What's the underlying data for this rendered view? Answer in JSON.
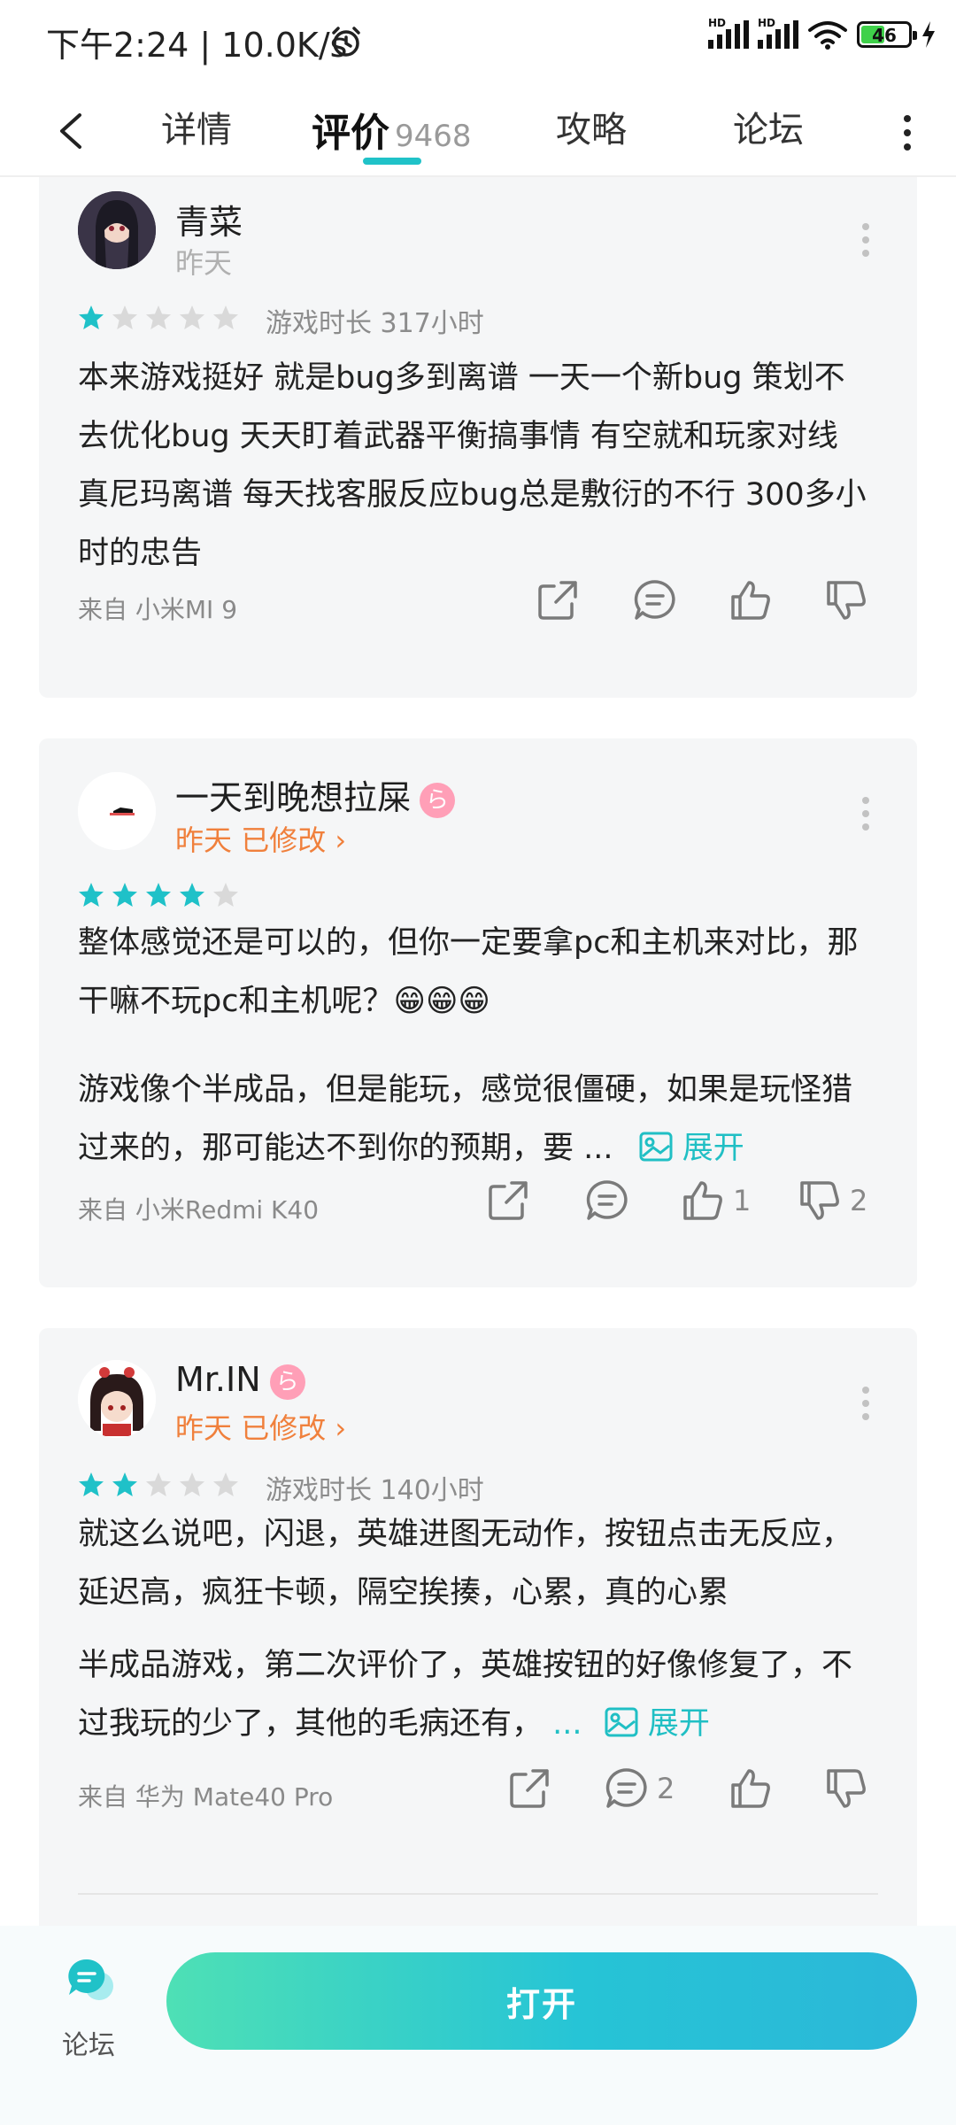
{
  "status_bar": {
    "time": "下午2:24 | 10.0K/s",
    "signal_label": "HD",
    "battery": "46"
  },
  "nav": {
    "tabs": [
      {
        "label": "详情"
      },
      {
        "label": "评价",
        "count": "9468"
      },
      {
        "label": "攻略"
      },
      {
        "label": "论坛"
      }
    ]
  },
  "reviews": [
    {
      "user": "青菜",
      "date": "昨天",
      "edited": "",
      "rating": 1,
      "playtime": "游戏时长 317小时",
      "text": "本来游戏挺好 就是bug多到离谱 一天一个新bug 策划不去优化bug 天天盯着武器平衡搞事情 有空就和玩家对线 真尼玛离谱 每天找客服反应bug总是敷衍的不行 300多小时的忠告",
      "source": "来自 小米MI 9",
      "likes": "",
      "dislikes": "",
      "comments": ""
    },
    {
      "user": "一天到晚想拉屎",
      "date": "昨天",
      "edited": "已修改 ›",
      "rating": 4,
      "playtime": "",
      "text": "整体感觉还是可以的，但你一定要拿pc和主机来对比，那干嘛不玩pc和主机呢？😁😁😁",
      "text2": "游戏像个半成品，但是能玩，感觉很僵硬，如果是玩怪猎过来的，那可能达不到你的预期，要 ...",
      "expand": "展开",
      "source": "来自 小米Redmi K40",
      "likes": "1",
      "dislikes": "2",
      "comments": ""
    },
    {
      "user": "Mr.IN",
      "date": "昨天",
      "edited": "已修改 ›",
      "rating": 2,
      "playtime": "游戏时长 140小时",
      "text": "就这么说吧，闪退，英雄进图无动作，按钮点击无反应，延迟高，疯狂卡顿，隔空挨揍，心累，真的心累",
      "text2": "半成品游戏，第二次评价了，英雄按钮的好像修复了，不过我玩的少了，其他的毛病还有，",
      "text2_more": " ...",
      "expand": "展开",
      "source": "来自 华为 Mate40 Pro",
      "likes": "",
      "dislikes": "",
      "comments": "2"
    }
  ],
  "bottom_bar": {
    "forum_label": "论坛",
    "open_button": "打开"
  },
  "colors": {
    "accent": "#20c2c8",
    "star_on": "#1fc1c8",
    "star_off": "#d9d9d9",
    "edited": "#f0803c"
  }
}
